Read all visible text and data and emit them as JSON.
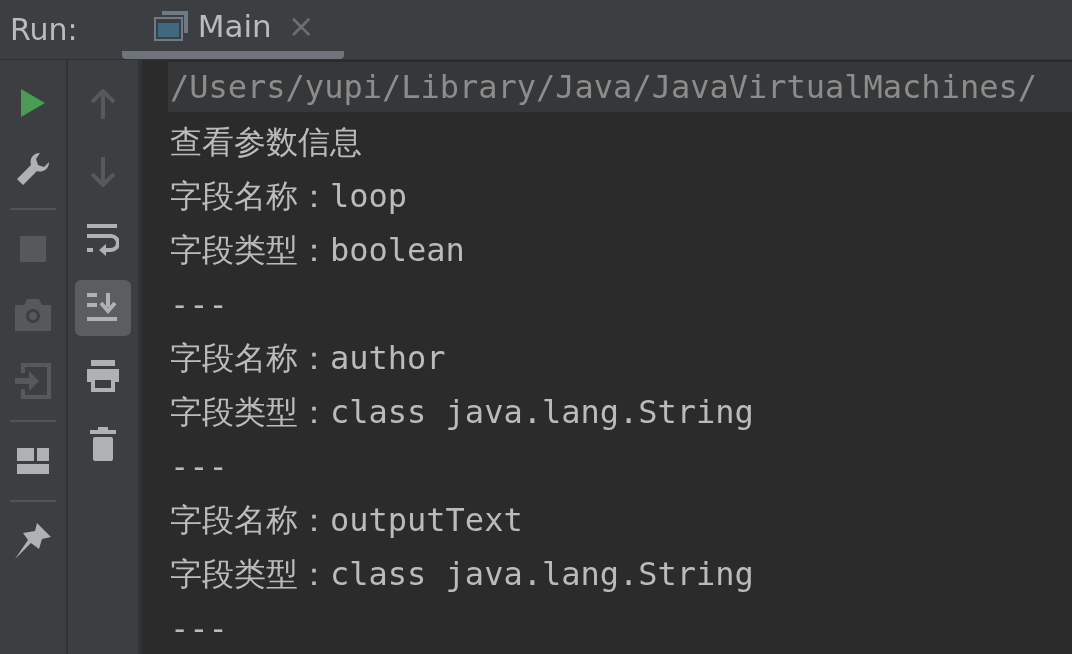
{
  "header": {
    "label": "Run:"
  },
  "tabs": [
    {
      "label": "Main",
      "close": "×",
      "selected": true
    }
  ],
  "left_toolbar": [
    {
      "kind": "run",
      "disabled": false
    },
    {
      "kind": "wrench",
      "disabled": false
    },
    {
      "kind": "separator"
    },
    {
      "kind": "stop",
      "disabled": true
    },
    {
      "kind": "camera",
      "disabled": true
    },
    {
      "kind": "exit",
      "disabled": true
    },
    {
      "kind": "separator"
    },
    {
      "kind": "layout",
      "disabled": false
    },
    {
      "kind": "separator"
    },
    {
      "kind": "pin",
      "disabled": false
    }
  ],
  "right_toolbar": [
    {
      "kind": "up",
      "disabled": true,
      "selected": false
    },
    {
      "kind": "down",
      "disabled": true,
      "selected": false
    },
    {
      "kind": "wrap",
      "disabled": false,
      "selected": false
    },
    {
      "kind": "scroll-end",
      "disabled": false,
      "selected": true
    },
    {
      "kind": "print",
      "disabled": false,
      "selected": false
    },
    {
      "kind": "trash",
      "disabled": false,
      "selected": false
    }
  ],
  "console": [
    {
      "kind": "command",
      "text": "/Users/yupi/Library/Java/JavaVirtualMachines/"
    },
    {
      "kind": "output",
      "text": "查看参数信息"
    },
    {
      "kind": "output",
      "text": "字段名称：loop"
    },
    {
      "kind": "output",
      "text": "字段类型：boolean"
    },
    {
      "kind": "output",
      "text": "---"
    },
    {
      "kind": "output",
      "text": "字段名称：author"
    },
    {
      "kind": "output",
      "text": "字段类型：class java.lang.String"
    },
    {
      "kind": "output",
      "text": "---"
    },
    {
      "kind": "output",
      "text": "字段名称：outputText"
    },
    {
      "kind": "output",
      "text": "字段类型：class java.lang.String"
    },
    {
      "kind": "output",
      "text": "---"
    }
  ]
}
